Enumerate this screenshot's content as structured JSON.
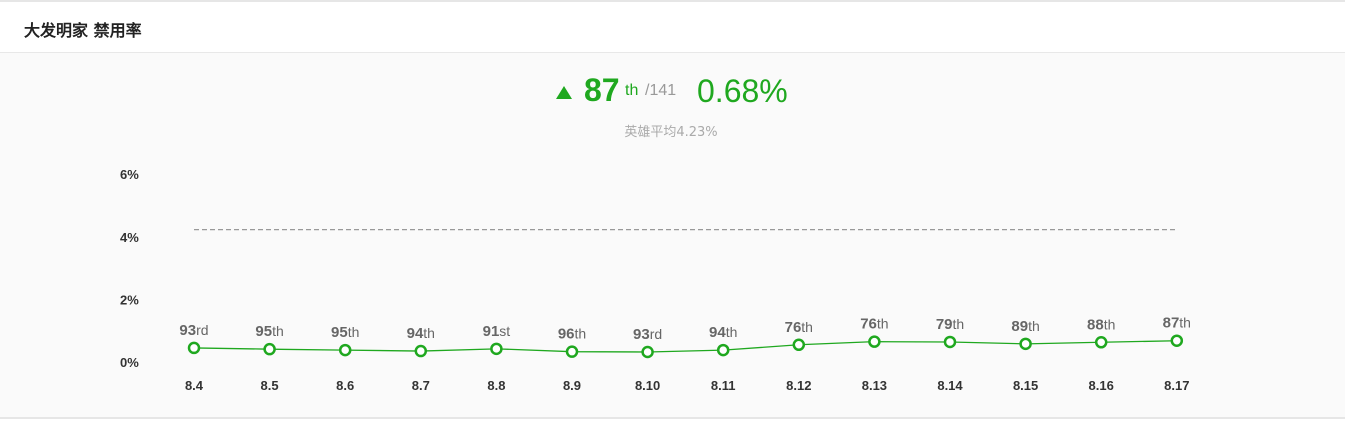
{
  "header": {
    "title": "大发明家 禁用率"
  },
  "summary": {
    "rank": "87",
    "rank_suffix": "th",
    "rank_total": "/141",
    "rate": "0.68%",
    "average_text": "英雄平均4.23%"
  },
  "colors": {
    "accent": "#1fa81f",
    "average_line": "#999999"
  },
  "chart_data": {
    "type": "line",
    "categories": [
      "8.4",
      "8.5",
      "8.6",
      "8.7",
      "8.8",
      "8.9",
      "8.10",
      "8.11",
      "8.12",
      "8.13",
      "8.14",
      "8.15",
      "8.16",
      "8.17"
    ],
    "series": [
      {
        "values": [
          0.45,
          0.41,
          0.38,
          0.35,
          0.42,
          0.33,
          0.32,
          0.38,
          0.55,
          0.65,
          0.64,
          0.58,
          0.63,
          0.68
        ]
      }
    ],
    "rank_labels": [
      {
        "num": "93",
        "suf": "rd"
      },
      {
        "num": "95",
        "suf": "th"
      },
      {
        "num": "95",
        "suf": "th"
      },
      {
        "num": "94",
        "suf": "th"
      },
      {
        "num": "91",
        "suf": "st"
      },
      {
        "num": "96",
        "suf": "th"
      },
      {
        "num": "93",
        "suf": "rd"
      },
      {
        "num": "94",
        "suf": "th"
      },
      {
        "num": "76",
        "suf": "th"
      },
      {
        "num": "76",
        "suf": "th"
      },
      {
        "num": "79",
        "suf": "th"
      },
      {
        "num": "89",
        "suf": "th"
      },
      {
        "num": "88",
        "suf": "th"
      },
      {
        "num": "87",
        "suf": "th"
      }
    ],
    "average": 4.23,
    "y_ticks": [
      0,
      2,
      4,
      6
    ],
    "y_tick_labels": [
      "0%",
      "2%",
      "4%",
      "6%"
    ],
    "ylim": [
      0,
      6
    ],
    "grid": false,
    "legend": "none"
  }
}
